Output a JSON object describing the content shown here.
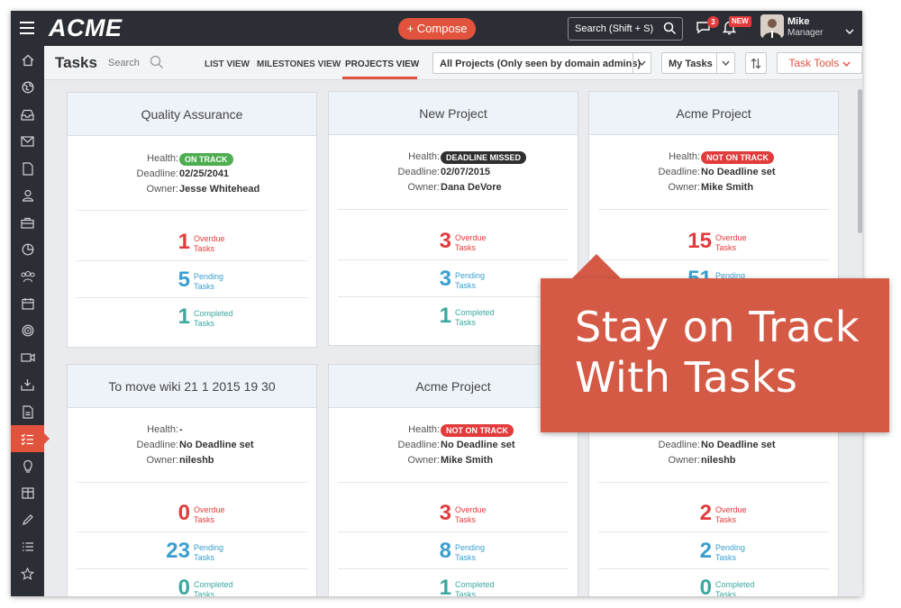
{
  "app": {
    "logo": "ACME"
  },
  "topbar": {
    "compose_label": "+ Compose",
    "search_placeholder": "Search (Shift + S)",
    "chat_badge": "3",
    "bell_badge": "NEW",
    "user_name": "Mike",
    "user_role": "Manager"
  },
  "sidebar": {
    "icons": [
      "home-icon",
      "globe-icon",
      "inbox-icon",
      "mail-icon",
      "document-icon",
      "person-icon",
      "briefcase-icon",
      "pie-chart-icon",
      "people-icon",
      "calendar-icon",
      "target-icon",
      "video-icon",
      "download-tray-icon",
      "report-icon",
      "tasks-icon",
      "lightbulb-icon",
      "table-icon",
      "pencil-icon",
      "list-icon",
      "star-icon"
    ],
    "active": "tasks-icon"
  },
  "header": {
    "title": "Tasks",
    "search_label": "Search",
    "tabs": [
      "LIST VIEW",
      "MILESTONES VIEW",
      "PROJECTS VIEW"
    ],
    "active_tab": "PROJECTS VIEW",
    "project_filter": "All Projects (Only seen by domain admins)",
    "task_filter": "My Tasks",
    "tools_label": "Task Tools"
  },
  "field_labels": {
    "health": "Health:",
    "deadline": "Deadline:",
    "owner": "Owner:"
  },
  "stat_labels": {
    "overdue": [
      "Overdue",
      "Tasks"
    ],
    "pending": [
      "Pending",
      "Tasks"
    ],
    "completed": [
      "Completed",
      "Tasks"
    ]
  },
  "projects": [
    {
      "name": "Quality Assurance",
      "health": "ON TRACK",
      "health_color": "#4cae4f",
      "deadline": "02/25/2041",
      "owner": "Jesse Whitehead",
      "overdue": "1",
      "pending": "5",
      "completed": "1"
    },
    {
      "name": "New Project",
      "health": "DEADLINE MISSED",
      "health_color": "#2f2f2f",
      "deadline": "02/07/2015",
      "owner": "Dana DeVore",
      "overdue": "3",
      "pending": "3",
      "completed": "1"
    },
    {
      "name": "Acme Project",
      "health": "NOT ON TRACK",
      "health_color": "#e23b3b",
      "deadline": "No Deadline set",
      "owner": "Mike Smith",
      "overdue": "15",
      "pending": "51",
      "completed": ""
    },
    {
      "name": "To move wiki 21 1 2015 19 30",
      "health": "-",
      "deadline": "No Deadline set",
      "owner": "nileshb",
      "overdue": "0",
      "pending": "23",
      "completed": "0"
    },
    {
      "name": "Acme Project",
      "health": "NOT ON TRACK",
      "health_color": "#e23b3b",
      "deadline": "No Deadline set",
      "owner": "Mike Smith",
      "overdue": "3",
      "pending": "8",
      "completed": "1"
    },
    {
      "name": "",
      "health": "",
      "deadline": "No Deadline set",
      "owner": "nileshb",
      "overdue": "2",
      "pending": "2",
      "completed": "0"
    }
  ],
  "callout": {
    "line1": "Stay on Track",
    "line2": "With Tasks"
  }
}
